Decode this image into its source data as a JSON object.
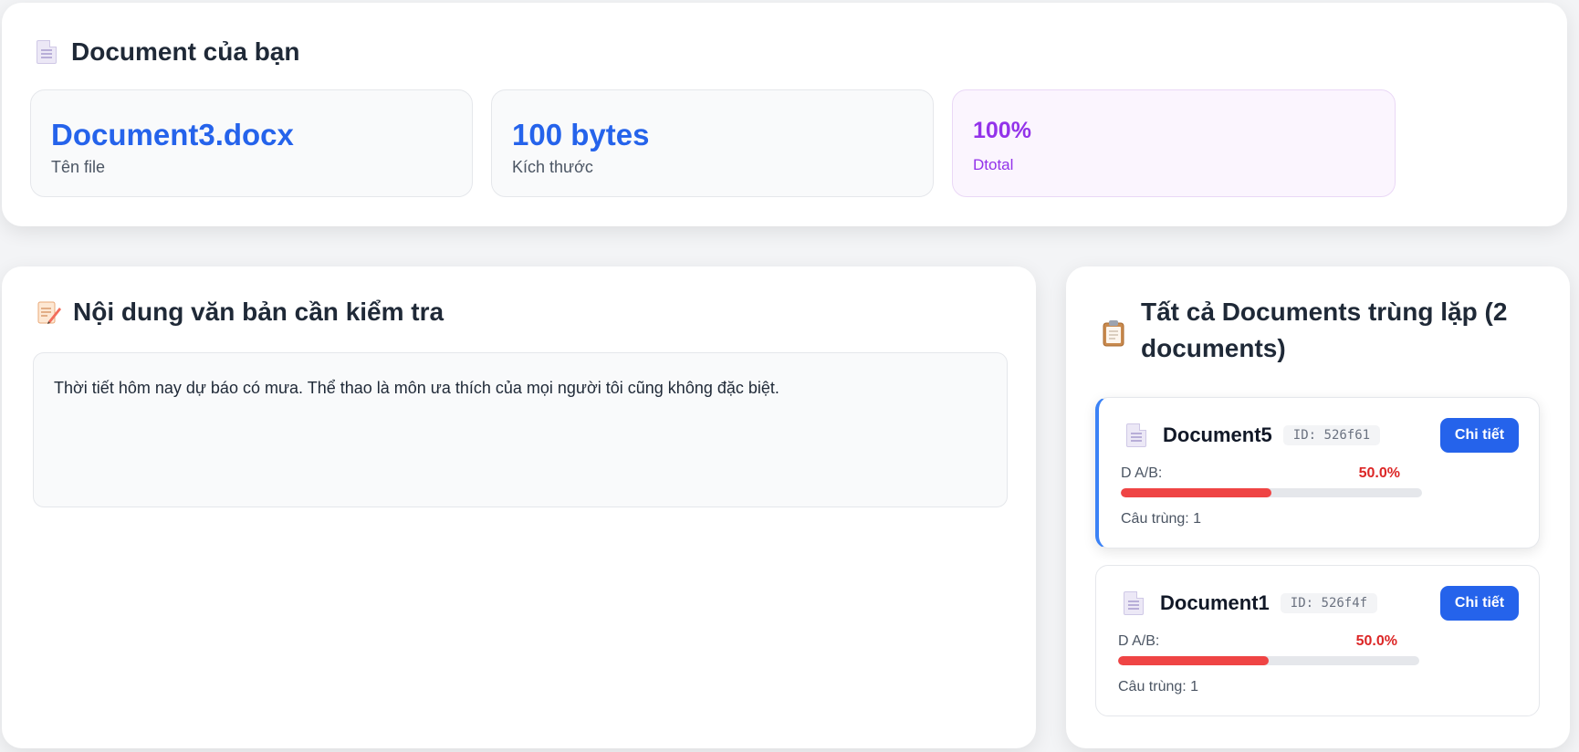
{
  "top": {
    "title": "Document của bạn",
    "file_name": "Document3.docx",
    "file_name_label": "Tên file",
    "size": "100 bytes",
    "size_label": "Kích thước",
    "dtotal": "100%",
    "dtotal_label": "Dtotal"
  },
  "content": {
    "title": "Nội dung văn bản cần kiểm tra",
    "text": "Thời tiết hôm nay dự báo có mưa. Thể thao là môn ưa thích của mọi người tôi cũng không đặc biệt."
  },
  "duplicates": {
    "title_line1": "Tất cả Documents trùng lặp (2",
    "title_line2": "documents)",
    "items": [
      {
        "name": "Document5",
        "id": "ID: 526f61",
        "button_label": "Chi tiết",
        "metric_label": "D A/B:",
        "metric_value": "50.0%",
        "progress": 0.5,
        "match_count": "Câu trùng: 1"
      },
      {
        "name": "Document1",
        "id": "ID: 526f4f",
        "button_label": "Chi tiết",
        "metric_label": "D A/B:",
        "metric_value": "50.0%",
        "progress": 0.5,
        "match_count": "Câu trùng: 1"
      }
    ]
  },
  "colors": {
    "accent": "#2563eb",
    "purple": "#9333ea",
    "danger": "#ef4444"
  },
  "icons": {
    "top": "document-icon",
    "content": "memo-pencil-icon",
    "duplicates": "clipboard-icon"
  }
}
